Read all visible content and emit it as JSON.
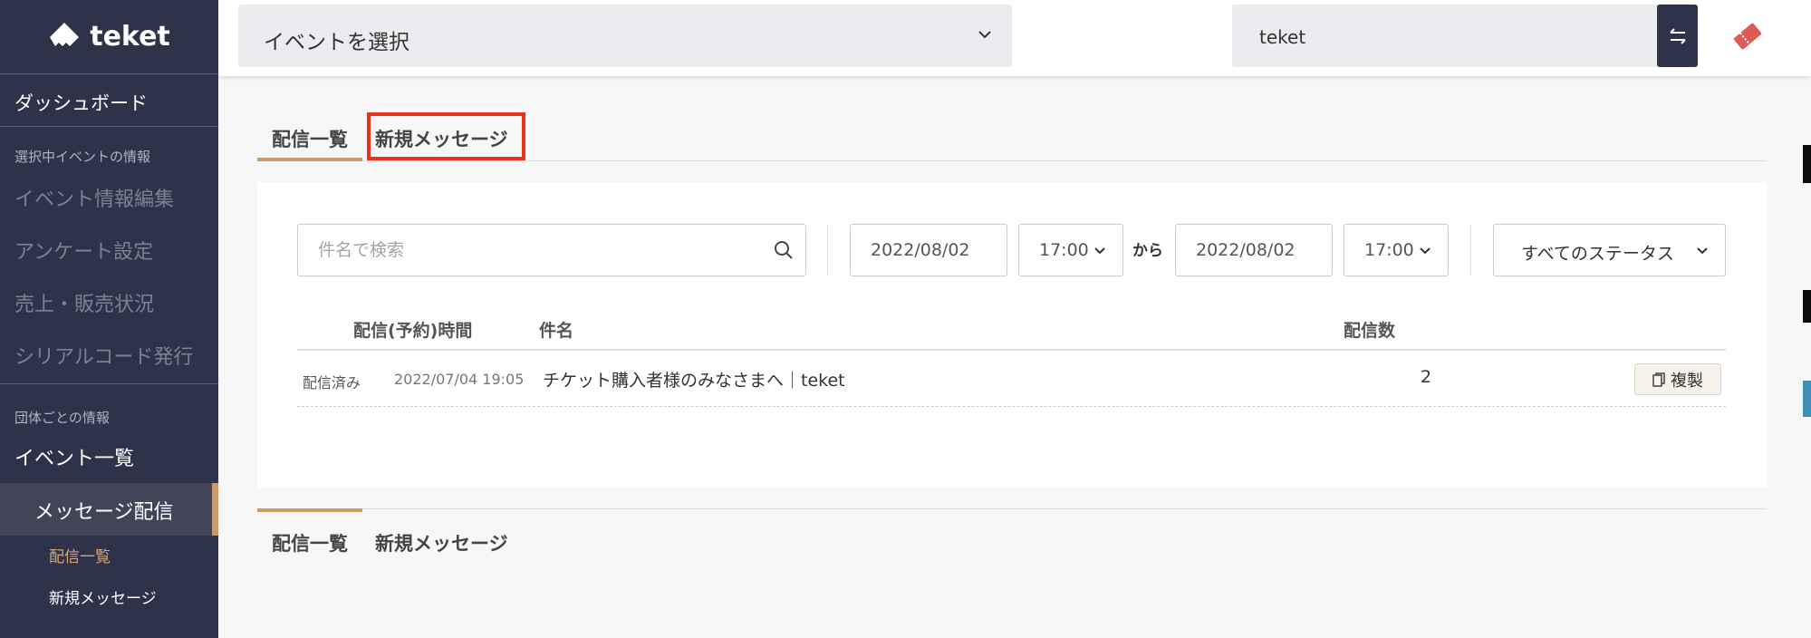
{
  "brand": {
    "name": "teket",
    "accent": "#c89a6c",
    "sidebar_bg": "#2e3349"
  },
  "sidebar": {
    "dashboard": "ダッシュボード",
    "section_event_info": "選択中イベントの情報",
    "event_edit": "イベント情報編集",
    "survey_settings": "アンケート設定",
    "sales_status": "売上・販売状況",
    "serial_code": "シリアルコード発行",
    "section_org_info": "団体ごとの情報",
    "event_list": "イベント一覧",
    "message_delivery": "メッセージ配信",
    "sub_delivery_list": "配信一覧",
    "sub_new_message": "新規メッセージ"
  },
  "topbar": {
    "event_select_label": "イベントを選択",
    "org_name": "teket",
    "swap_icon": "swap-arrows-icon",
    "ticket_icon": "ticket-icon"
  },
  "tabs": {
    "delivery_list": "配信一覧",
    "new_message": "新規メッセージ"
  },
  "filters": {
    "search_placeholder": "件名で検索",
    "date_from": "2022/08/02",
    "time_from": "17:00",
    "range_sep": "から",
    "date_to": "2022/08/02",
    "time_to": "17:00",
    "status": "すべてのステータス"
  },
  "table": {
    "headers": {
      "time": "配信(予約)時間",
      "subject": "件名",
      "count": "配信数"
    },
    "rows": [
      {
        "status": "配信済み",
        "time": "2022/07/04 19:05",
        "subject": "チケット購入者様のみなさまへ｜teket",
        "count": "2",
        "action": "複製"
      }
    ]
  }
}
